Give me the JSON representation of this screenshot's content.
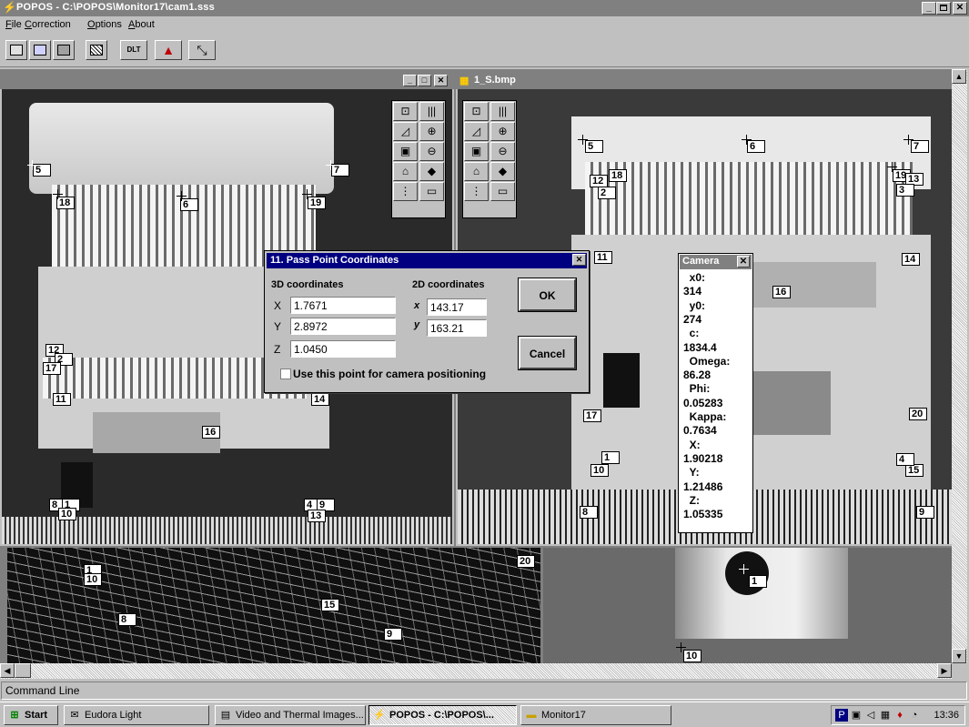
{
  "titlebar": {
    "title": "POPOS - C:\\POPOS\\Monitor17\\cam1.sss",
    "minimize": "_",
    "maximize": "▫",
    "close": "✕"
  },
  "menu": {
    "items": [
      {
        "label": "File"
      },
      {
        "label": "Correction"
      },
      {
        "label": "Options"
      },
      {
        "label": "About"
      }
    ]
  },
  "toolbar": {
    "dlt_label": "DLT"
  },
  "left_window": {
    "minimize": "_",
    "maximize": "□",
    "close": "✕",
    "points": [
      "5",
      "7",
      "18",
      "6",
      "19",
      "12",
      "2",
      "17",
      "11",
      "14",
      "16",
      "8",
      "1",
      "10",
      "4",
      "9",
      "13"
    ]
  },
  "right_window": {
    "title": "1_S.bmp",
    "points": [
      "5",
      "6",
      "7",
      "12",
      "18",
      "2",
      "19",
      "13",
      "3",
      "11",
      "14",
      "16",
      "17",
      "20",
      "1",
      "10",
      "15",
      "4",
      "8",
      "9"
    ]
  },
  "edge_window": {
    "points": [
      "1",
      "10",
      "20",
      "15",
      "8",
      "9"
    ]
  },
  "zoom_window": {
    "points": [
      "1",
      "10"
    ]
  },
  "dialog": {
    "title": "11. Pass Point Coordinates",
    "close": "✕",
    "heading_3d": "3D coordinates",
    "heading_2d": "2D coordinates",
    "x_label": "X",
    "y_label": "Y",
    "z_label": "Z",
    "x_value": "1.7671",
    "y_value": "2.8972",
    "z_value": "1.0450",
    "x2d_label": "x",
    "y2d_label": "y",
    "x2d_value": "143.17",
    "y2d_value": "163.21",
    "checkbox_label": "Use this point for camera positioning",
    "checkbox_checked": false,
    "ok_label": "OK",
    "cancel_label": "Cancel"
  },
  "camera": {
    "title": "Camera",
    "close": "✕",
    "rows": [
      "  x0:",
      "314",
      "  y0:",
      "274",
      "  c:",
      "1834.4",
      "  Omega:",
      "86.28",
      "  Phi:",
      "0.05283",
      "  Kappa:",
      "0.7634",
      "  X:",
      "1.90218",
      "  Y:",
      "1.21486",
      "  Z:",
      "1.05335"
    ]
  },
  "command_line": {
    "label": "Command Line"
  },
  "taskbar": {
    "start_label": "Start",
    "tasks": [
      {
        "label": "Eudora Light",
        "icon": "eudora-icon"
      },
      {
        "label": "Video and Thermal Images...",
        "icon": "image-folder-icon"
      },
      {
        "label": "POPOS - C:\\POPOS\\...",
        "icon": "popos-icon",
        "active": true
      },
      {
        "label": "Monitor17",
        "icon": "folder-icon"
      }
    ],
    "clock": "13:36"
  }
}
